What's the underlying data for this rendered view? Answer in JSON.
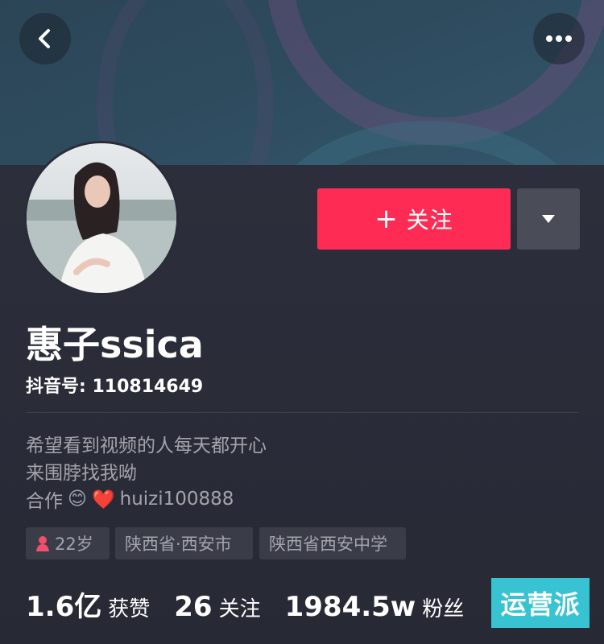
{
  "header": {
    "back_icon": "chevron-left-icon",
    "more_icon": "ellipsis-icon"
  },
  "profile": {
    "follow_label": "关注",
    "follow_plus": "+",
    "follow_color": "#fe2c55",
    "dropdown_icon": "caret-down-icon",
    "username": "惠子ssica",
    "douyin_id": "抖音号: 110814649",
    "bio": {
      "line1": "希望看到视频的人每天都开心",
      "line2": "来围脖找我呦",
      "line3_prefix": "合作",
      "line3_emoji1": "😊",
      "line3_emoji2": "❤️",
      "line3_handle": "huizi100888"
    },
    "tags": {
      "age": "22岁",
      "location": "陕西省·西安市",
      "school": "陕西省西安中学"
    },
    "stats": {
      "likes_value": "1.6亿",
      "likes_label": "获赞",
      "following_value": "26",
      "following_label": "关注",
      "followers_value": "1984.5w",
      "followers_label": "粉丝"
    }
  },
  "watermark": {
    "text": "运营派",
    "color": "#38c3d3"
  }
}
